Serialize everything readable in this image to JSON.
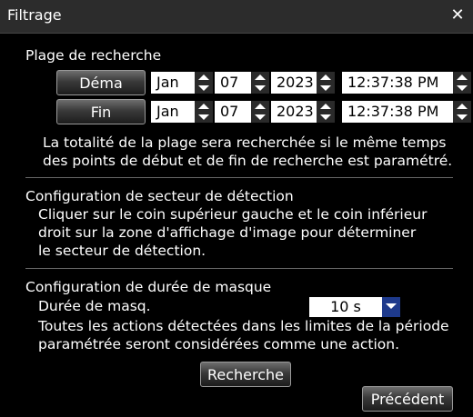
{
  "window": {
    "title": "Filtrage",
    "close_glyph": "✕"
  },
  "search_range": {
    "heading": "Plage de recherche",
    "start": {
      "button_label": "Déma",
      "month": "Jan",
      "day": "07",
      "year": "2023",
      "time": "12:37:38 PM"
    },
    "end": {
      "button_label": "Fin",
      "month": "Jan",
      "day": "07",
      "year": "2023",
      "time": "12:37:38 PM"
    },
    "note_line1": "La totalité de la plage sera recherchée si le même temps",
    "note_line2": "des points de début et de fin de recherche est paramétré."
  },
  "detection_area": {
    "heading": "Configuration de secteur de détection",
    "line1": "Cliquer sur le coin supérieur gauche et le coin inférieur",
    "line2": "droit sur la zone d'affichage d'image pour déterminer",
    "line3": "le secteur de détection."
  },
  "mask": {
    "heading": "Configuration de durée de masque",
    "duration_label": "Durée de masq.",
    "duration_value": "10 s",
    "line1": "Toutes les actions détectées dans les limites de la période",
    "line2": "paramétrée seront considérées comme une action."
  },
  "buttons": {
    "search": "Recherche",
    "previous": "Précédent"
  }
}
